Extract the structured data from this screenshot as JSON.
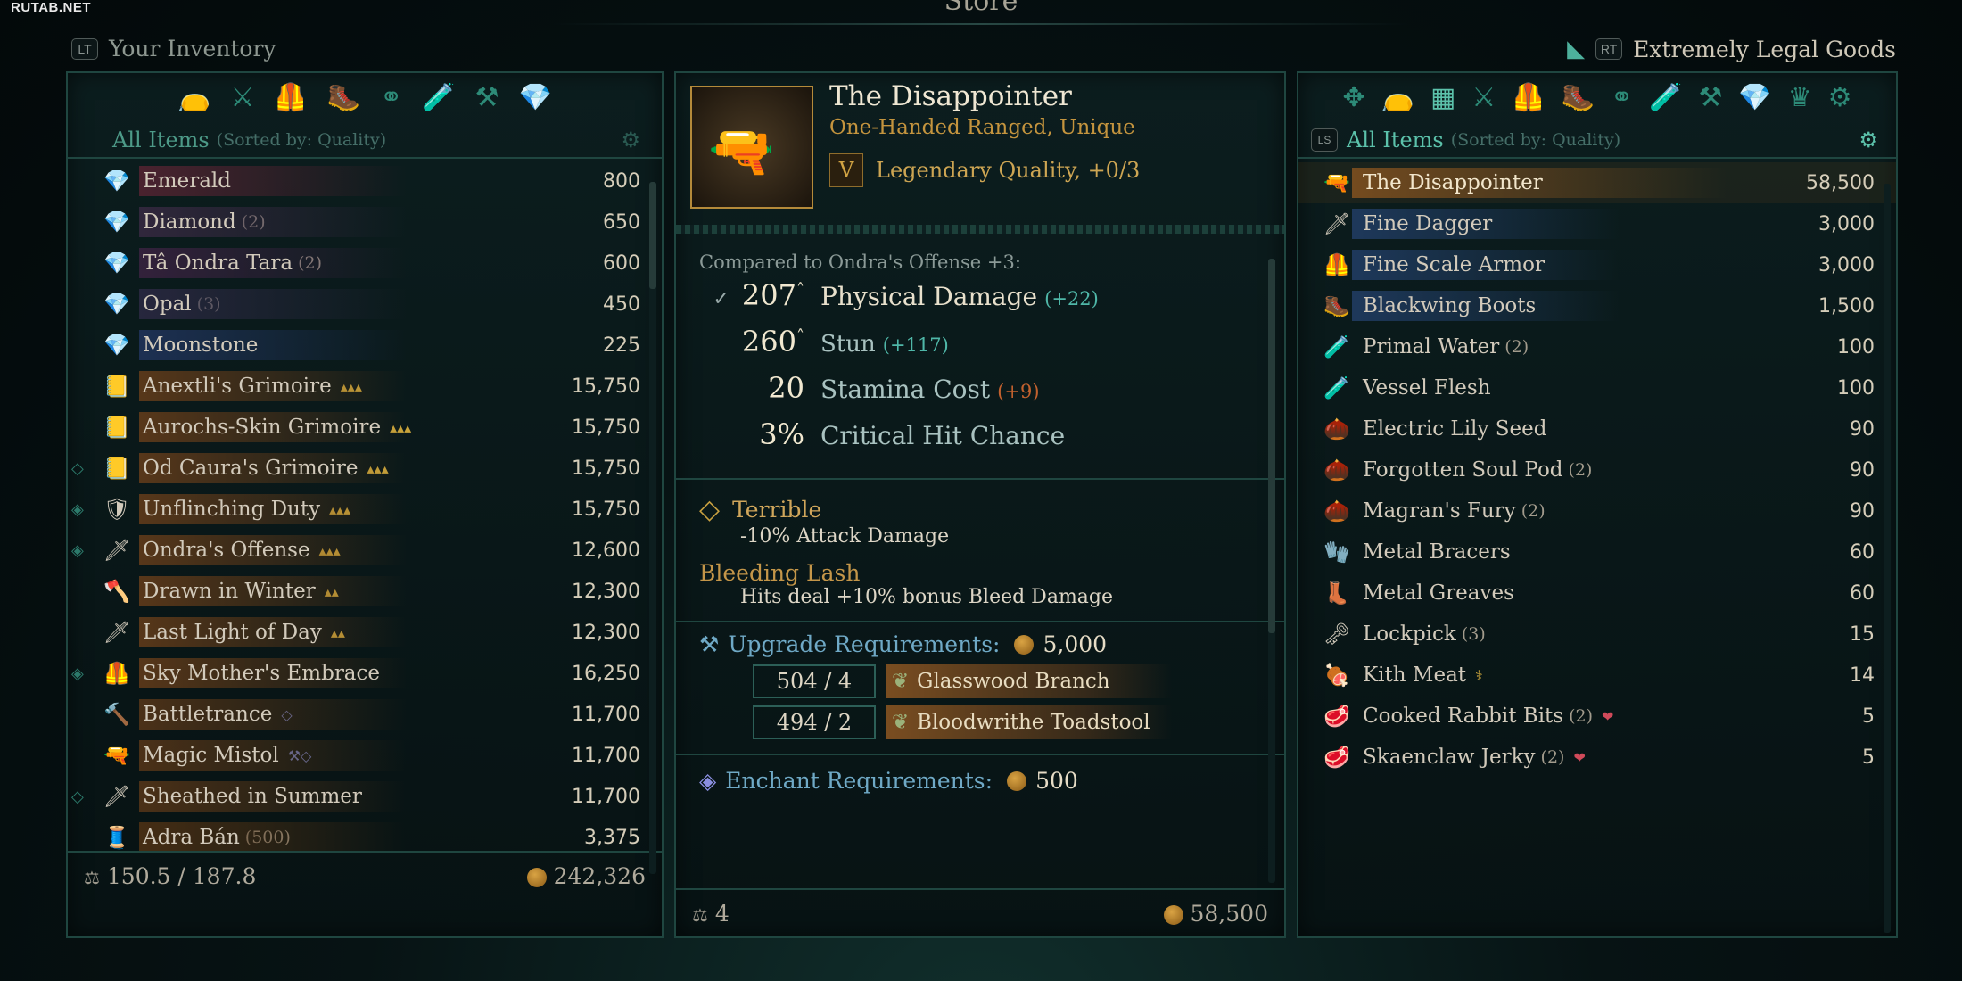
{
  "watermark": "RUTAB.NET",
  "window_title": "Store",
  "left": {
    "key": "LT",
    "title": "Your Inventory",
    "sort_label": "All Items",
    "sort_sub": "(Sorted by: Quality)",
    "categories": [
      "pouch-icon",
      "weapons-icon",
      "armor-icon",
      "boots-icon",
      "rings-icon",
      "consumables-icon",
      "anvil-icon",
      "gem-icon"
    ],
    "items": [
      {
        "icon": "💎",
        "name": "Emerald",
        "qty": "",
        "marks": "",
        "value": "800",
        "glow": "#5a2433",
        "diamond": ""
      },
      {
        "icon": "💎",
        "name": "Diamond",
        "qty": "(2)",
        "marks": "",
        "value": "650",
        "glow": "#3a2a44",
        "diamond": ""
      },
      {
        "icon": "💎",
        "name": "Tâ Ondra Tara",
        "qty": "(2)",
        "marks": "",
        "value": "600",
        "glow": "#3d2343",
        "diamond": ""
      },
      {
        "icon": "💎",
        "name": "Opal",
        "qty": "(3)",
        "marks": "",
        "value": "450",
        "glow": "#2e2a46",
        "diamond": ""
      },
      {
        "icon": "💎",
        "name": "Moonstone",
        "qty": "",
        "marks": "",
        "value": "225",
        "glow": "#223661",
        "diamond": ""
      },
      {
        "icon": "📒",
        "name": "Anextli's Grimoire",
        "qty": "",
        "marks": "▴▴▴",
        "value": "15,750",
        "glow": "#6b3f1a",
        "diamond": ""
      },
      {
        "icon": "📒",
        "name": "Aurochs-Skin Grimoire",
        "qty": "",
        "marks": "▴▴▴",
        "value": "15,750",
        "glow": "#6b3f1a",
        "diamond": ""
      },
      {
        "icon": "📒",
        "name": "Od Caura's Grimoire",
        "qty": "",
        "marks": "▴▴▴",
        "value": "15,750",
        "glow": "#6b3f1a",
        "diamond": "◇"
      },
      {
        "icon": "🛡",
        "name": "Unflinching Duty",
        "qty": "",
        "marks": "▴▴▴",
        "value": "15,750",
        "glow": "#6b3f1a",
        "diamond": "◈"
      },
      {
        "icon": "🗡",
        "name": "Ondra's Offense",
        "qty": "",
        "marks": "▴▴▴",
        "value": "12,600",
        "glow": "#6b3f1a",
        "diamond": "◈"
      },
      {
        "icon": "🪓",
        "name": "Drawn in Winter",
        "qty": "",
        "marks": "▴▴",
        "value": "12,300",
        "glow": "#6b3f1a",
        "diamond": ""
      },
      {
        "icon": "🗡",
        "name": "Last Light of Day",
        "qty": "",
        "marks": "▴▴",
        "value": "12,300",
        "glow": "#6b3f1a",
        "diamond": ""
      },
      {
        "icon": "🦺",
        "name": "Sky Mother's Embrace",
        "qty": "",
        "marks": "",
        "value": "16,250",
        "glow": "#6b3f1a",
        "diamond": "◈"
      },
      {
        "icon": "🔨",
        "name": "Battletrance",
        "qty": "",
        "marks": "◇",
        "value": "11,700",
        "glow": "#5c3818",
        "diamond": ""
      },
      {
        "icon": "🔫",
        "name": "Magic Mistol",
        "qty": "",
        "marks": "⚒◇",
        "value": "11,700",
        "glow": "#5c3818",
        "diamond": ""
      },
      {
        "icon": "🗡",
        "name": "Sheathed in Summer",
        "qty": "",
        "marks": "",
        "value": "11,700",
        "glow": "#5c3818",
        "diamond": "◇"
      },
      {
        "icon": "🧵",
        "name": "Adra Bán",
        "qty": "(500)",
        "marks": "",
        "value": "3,375",
        "glow": "#553414",
        "diamond": ""
      }
    ],
    "weight": "150.5 / 187.8",
    "gold": "242,326"
  },
  "center": {
    "item_name": "The Disappointer",
    "item_type": "One-Handed Ranged, Unique",
    "quality_badge": "V",
    "quality": "Legendary Quality, +0/3",
    "compared": "Compared to Ondra's Offense +3:",
    "stats": [
      {
        "num": "207",
        "up": "˄",
        "label": "Physical Damage",
        "diff": "(+22)",
        "diff_color": "#4fb7a8",
        "icon": "✓"
      },
      {
        "num": "260",
        "up": "˄",
        "label": "Stun",
        "diff": "(+117)",
        "diff_color": "#4fb7a8",
        "icon": ""
      },
      {
        "num": "20",
        "up": "",
        "label": "Stamina Cost",
        "diff": "(+9)",
        "diff_color": "#c2612e",
        "icon": ""
      },
      {
        "num": "3%",
        "up": "",
        "label": "Critical Hit Chance",
        "diff": "",
        "diff_color": "#4fb7a8",
        "icon": ""
      }
    ],
    "trait1_name": "Terrible",
    "trait1_desc": "-10% Attack Damage",
    "trait2_name": "Bleeding Lash",
    "trait2_desc": "Hits deal +10% bonus Bleed Damage",
    "upgrade_label": "Upgrade Requirements:",
    "upgrade_cost": "5,000",
    "materials": [
      {
        "count": "504 / 4",
        "name": "Glasswood Branch"
      },
      {
        "count": "494 / 2",
        "name": "Bloodwrithe Toadstool"
      }
    ],
    "enchant_label": "Enchant Requirements:",
    "enchant_cost": "500",
    "weight": "4",
    "gold": "58,500"
  },
  "right": {
    "key": "RT",
    "title": "Extremely Legal Goods",
    "ls_key": "LS",
    "sort_label": "All Items",
    "sort_sub": "(Sorted by: Quality)",
    "categories": [
      "misc-icon",
      "pouch-icon",
      "all-items-icon",
      "weapons-icon",
      "armor-icon",
      "boots-icon",
      "rings-icon",
      "consumables-icon",
      "anvil-icon",
      "gem-icon",
      "crown-icon",
      "gear-icon"
    ],
    "items": [
      {
        "icon": "🔫",
        "name": "The Disappointer",
        "qty": "",
        "marks": "",
        "value": "58,500",
        "glow": "#8a5520",
        "sel": true
      },
      {
        "icon": "🗡",
        "name": "Fine Dagger",
        "qty": "",
        "marks": "",
        "value": "3,000",
        "glow": "#23406b"
      },
      {
        "icon": "🦺",
        "name": "Fine Scale Armor",
        "qty": "",
        "marks": "",
        "value": "3,000",
        "glow": "#23406b"
      },
      {
        "icon": "🥾",
        "name": "Blackwing Boots",
        "qty": "",
        "marks": "",
        "value": "1,500",
        "glow": "#23406b"
      },
      {
        "icon": "🧪",
        "name": "Primal Water",
        "qty": "(2)",
        "marks": "",
        "value": "100",
        "glow": ""
      },
      {
        "icon": "🧪",
        "name": "Vessel Flesh",
        "qty": "",
        "marks": "",
        "value": "100",
        "glow": ""
      },
      {
        "icon": "🌰",
        "name": "Electric Lily Seed",
        "qty": "",
        "marks": "",
        "value": "90",
        "glow": ""
      },
      {
        "icon": "🌰",
        "name": "Forgotten Soul Pod",
        "qty": "(2)",
        "marks": "",
        "value": "90",
        "glow": ""
      },
      {
        "icon": "🌰",
        "name": "Magran's Fury",
        "qty": "(2)",
        "marks": "",
        "value": "90",
        "glow": ""
      },
      {
        "icon": "🧤",
        "name": "Metal Bracers",
        "qty": "",
        "marks": "",
        "value": "60",
        "glow": ""
      },
      {
        "icon": "👢",
        "name": "Metal Greaves",
        "qty": "",
        "marks": "",
        "value": "60",
        "glow": ""
      },
      {
        "icon": "🗝",
        "name": "Lockpick",
        "qty": "(3)",
        "marks": "",
        "value": "15",
        "glow": ""
      },
      {
        "icon": "🍖",
        "name": "Kith Meat",
        "qty": "",
        "marks": "⚕",
        "value": "14",
        "glow": ""
      },
      {
        "icon": "🥩",
        "name": "Cooked Rabbit Bits",
        "qty": "(2)",
        "marks": "❤",
        "value": "5",
        "glow": ""
      },
      {
        "icon": "🥩",
        "name": "Skaenclaw Jerky",
        "qty": "(2)",
        "marks": "❤",
        "value": "5",
        "glow": ""
      }
    ]
  },
  "colors": {
    "accent": "#5cc2ab",
    "border": "#1f4640",
    "gold": "#c8a33b",
    "selected_glow": "#8a5520"
  }
}
